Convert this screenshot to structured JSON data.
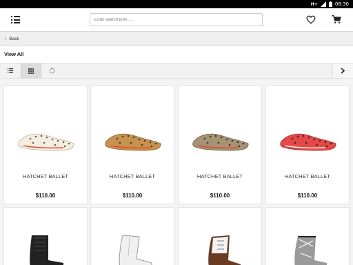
{
  "status_bar": {
    "network": "H+",
    "time": "08:30"
  },
  "header": {
    "search_placeholder": "Enter search term ...",
    "icons": [
      "menu-icon",
      "heart-icon",
      "cart-icon"
    ]
  },
  "nav": {
    "back_label": "Back"
  },
  "page": {
    "title": "View All"
  },
  "toolbar": {
    "icons": [
      "list-view-icon",
      "grid-view-icon",
      "refresh-icon",
      "chevron-right-icon"
    ],
    "active_view": "grid"
  },
  "products": [
    {
      "name": "HATCHET BALLET",
      "price": "$110.00",
      "color": "#f4eee0",
      "icon": "ballet-flat-white"
    },
    {
      "name": "HATCHET BALLET",
      "price": "$110.00",
      "color": "#c7924f",
      "icon": "ballet-flat-tan"
    },
    {
      "name": "HATCHET BALLET",
      "price": "$110.00",
      "color": "#a79273",
      "icon": "ballet-flat-taupe"
    },
    {
      "name": "HATCHET BALLET",
      "price": "$110.00",
      "color": "#e44848",
      "icon": "ballet-flat-coral"
    },
    {
      "icon": "boot-black",
      "color": "#222222"
    },
    {
      "icon": "boot-white",
      "color": "#f0f0f0"
    },
    {
      "icon": "boot-brown-white",
      "color": "#6a3a22"
    },
    {
      "icon": "boot-silver",
      "color": "#9a9a9a"
    }
  ]
}
